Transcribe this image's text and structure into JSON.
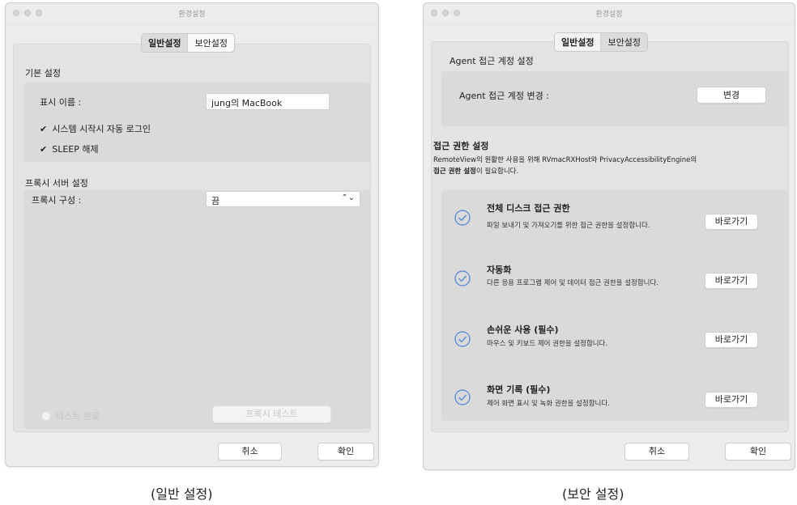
{
  "left_window": {
    "title": "환경설정",
    "tabs": {
      "general": "일반설정",
      "security": "보안설정"
    },
    "basic_section_title": "기본 설정",
    "display_name_label": "표시 이름 :",
    "display_name_value": "jung의 MacBook",
    "auto_login_label": "시스템 시작시 자동 로그인",
    "sleep_release_label": "SLEEP 해제",
    "proxy_section_title": "프록시 서버 설정",
    "proxy_config_label": "프록시 구성 :",
    "proxy_config_value": "끔",
    "test_complete_label": "테스트 완료",
    "proxy_test_button": "프록시 테스트",
    "cancel_button": "취소",
    "ok_button": "확인"
  },
  "right_window": {
    "title": "환경설정",
    "tabs": {
      "general": "일반설정",
      "security": "보안설정"
    },
    "agent_section_title": "Agent 접근 계정 설정",
    "agent_change_label": "Agent 접근 계정 변경 :",
    "change_button": "변경",
    "permission_section_title": "접근 권한 설정",
    "permission_desc_line1": "RemoteView의 원활한 사용을 위해 RVmacRXHost와 PrivacyAccessibilityEngine의",
    "permission_desc_bold": "접근 권한 설정",
    "permission_desc_rest": "이 필요합니다.",
    "permissions": [
      {
        "title": "전체 디스크 접근 권한",
        "desc": "파일 보내기 및 가져오기를 위한 접근 권한을 설정합니다.",
        "button": "바로가기"
      },
      {
        "title": "자동화",
        "desc": "다른 응용 프로그램 제어 및 데이터 접근 권한을 설정합니다.",
        "button": "바로가기"
      },
      {
        "title": "손쉬운 사용 (필수)",
        "desc": "마우스 및 키보드 제어 권한을 설정합니다.",
        "button": "바로가기"
      },
      {
        "title": "화면 기록 (필수)",
        "desc": "제어 화면 표시 및 녹화 권한을 설정합니다.",
        "button": "바로가기"
      }
    ],
    "cancel_button": "취소",
    "ok_button": "확인"
  },
  "captions": {
    "left": "(일반 설정)",
    "right": "(보안 설정)"
  },
  "colors": {
    "check_icon": "#4a84d8",
    "window_bg": "#ececec",
    "panel_bg": "#e3e3e3"
  },
  "icons": {
    "check": "checkmark",
    "permission": "circle-check-icon",
    "chevron": "updown-chevron-icon"
  }
}
